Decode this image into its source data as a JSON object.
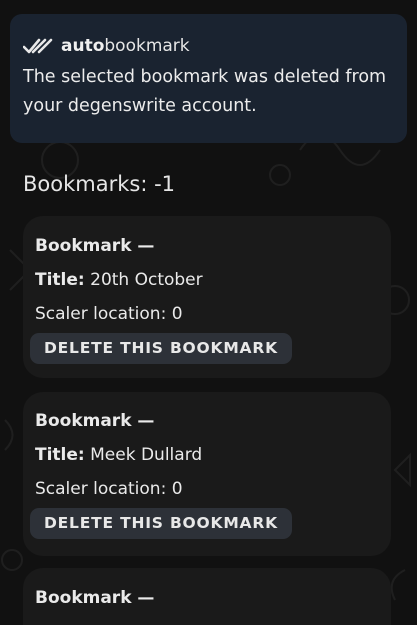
{
  "notice": {
    "brand_bold": "auto",
    "brand_light": "bookmark",
    "message": "The selected bookmark was deleted from your degenswrite account."
  },
  "bookmarks_count_label": "Bookmarks: -1",
  "cards": [
    {
      "head": "Bookmark —",
      "title_label": "Title:",
      "title_value": "20th October",
      "scaler_label": "Scaler location:",
      "scaler_value": "0",
      "delete_label": "DELETE THIS BOOKMARK"
    },
    {
      "head": "Bookmark —",
      "title_label": "Title:",
      "title_value": "Meek Dullard",
      "scaler_label": "Scaler location:",
      "scaler_value": "0",
      "delete_label": "DELETE THIS BOOKMARK"
    },
    {
      "head": "Bookmark —"
    }
  ],
  "icons": {
    "brand": "double-check-icon"
  },
  "colors": {
    "background": "#111111",
    "notice_bg": "#1a2330",
    "card_bg": "#1a1a1a",
    "button_bg": "#2d3138"
  }
}
